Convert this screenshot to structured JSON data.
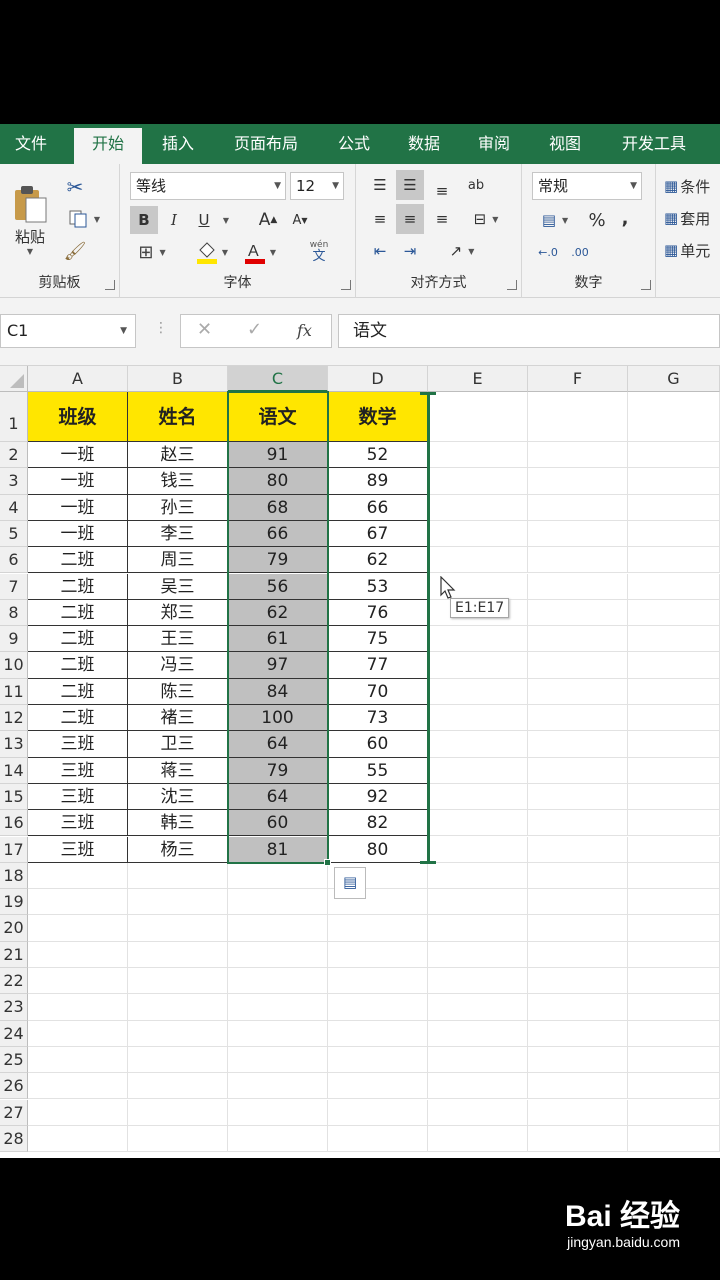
{
  "ribbon_tabs": [
    {
      "label": "文件",
      "active": false
    },
    {
      "label": "开始",
      "active": true
    },
    {
      "label": "插入",
      "active": false
    },
    {
      "label": "页面布局",
      "active": false
    },
    {
      "label": "公式",
      "active": false
    },
    {
      "label": "数据",
      "active": false
    },
    {
      "label": "审阅",
      "active": false
    },
    {
      "label": "视图",
      "active": false
    },
    {
      "label": "开发工具",
      "active": false
    }
  ],
  "clipboard": {
    "paste_label": "粘贴",
    "group_label": "剪贴板"
  },
  "font": {
    "name": "等线",
    "size": "12",
    "group_label": "字体",
    "bold": "B",
    "italic": "I",
    "underline": "U",
    "wen_label": "wén",
    "wen_char": "文"
  },
  "alignment": {
    "group_label": "对齐方式"
  },
  "number": {
    "format": "常规",
    "group_label": "数字",
    "percent": "%",
    "comma": ","
  },
  "styles": {
    "conditional": "条件",
    "table_format": "套用",
    "cell_styles": "单元"
  },
  "formula_bar": {
    "name_box": "C1",
    "fx": "fx",
    "content": "语文"
  },
  "columns": [
    "A",
    "B",
    "C",
    "D",
    "E",
    "F",
    "G"
  ],
  "selected_column": "C",
  "rows_count": 28,
  "table": {
    "headers": [
      "班级",
      "姓名",
      "语文",
      "数学"
    ],
    "rows": [
      [
        "一班",
        "赵三",
        "91",
        "52"
      ],
      [
        "一班",
        "钱三",
        "80",
        "89"
      ],
      [
        "一班",
        "孙三",
        "68",
        "66"
      ],
      [
        "一班",
        "李三",
        "66",
        "67"
      ],
      [
        "二班",
        "周三",
        "79",
        "62"
      ],
      [
        "二班",
        "吴三",
        "56",
        "53"
      ],
      [
        "二班",
        "郑三",
        "62",
        "76"
      ],
      [
        "二班",
        "王三",
        "61",
        "75"
      ],
      [
        "二班",
        "冯三",
        "97",
        "77"
      ],
      [
        "二班",
        "陈三",
        "84",
        "70"
      ],
      [
        "二班",
        "褚三",
        "100",
        "73"
      ],
      [
        "三班",
        "卫三",
        "64",
        "60"
      ],
      [
        "三班",
        "蒋三",
        "79",
        "55"
      ],
      [
        "三班",
        "沈三",
        "64",
        "92"
      ],
      [
        "三班",
        "韩三",
        "60",
        "82"
      ],
      [
        "三班",
        "杨三",
        "81",
        "80"
      ]
    ]
  },
  "drag_tooltip": "E1:E17",
  "watermark": {
    "brand": "Bai 经验",
    "url": "jingyan.baidu.com"
  },
  "colors": {
    "accent": "#217346",
    "header_fill": "#ffe600",
    "selection_fill": "#c0c0c0"
  }
}
